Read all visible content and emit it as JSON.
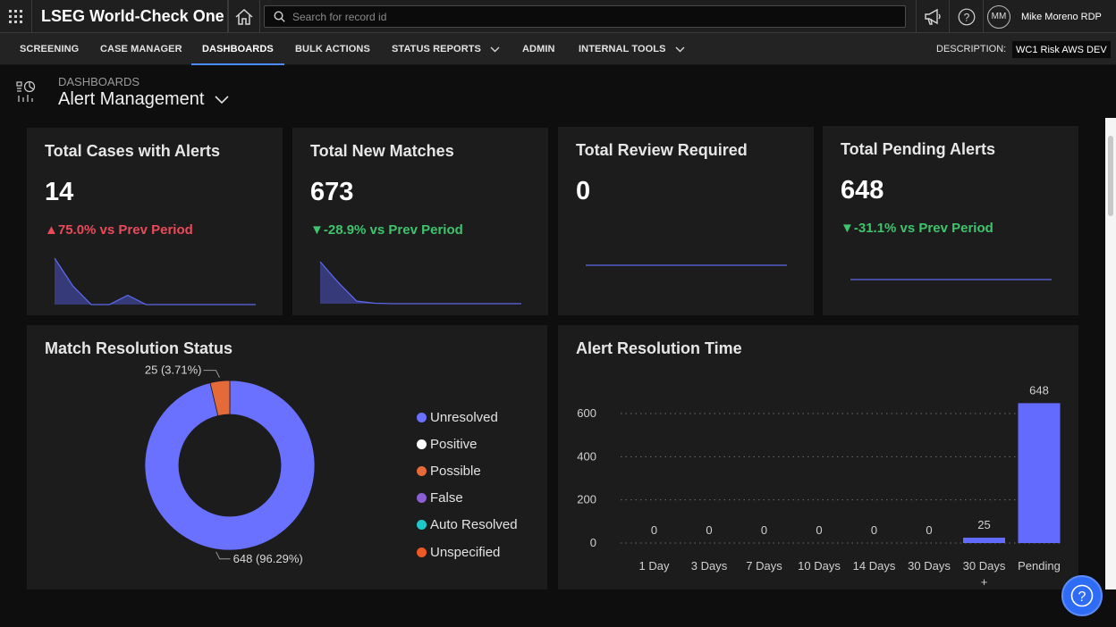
{
  "app": {
    "title": "LSEG World-Check One",
    "search_placeholder": "Search for record id",
    "user_initials": "MM",
    "user_name": "Mike Moreno RDP"
  },
  "nav": {
    "items": [
      {
        "label": "SCREENING",
        "has_dropdown": false,
        "active": false
      },
      {
        "label": "CASE MANAGER",
        "has_dropdown": false,
        "active": false
      },
      {
        "label": "DASHBOARDS",
        "has_dropdown": false,
        "active": true
      },
      {
        "label": "BULK ACTIONS",
        "has_dropdown": false,
        "active": false
      },
      {
        "label": "STATUS REPORTS",
        "has_dropdown": true,
        "active": false
      },
      {
        "label": "ADMIN",
        "has_dropdown": false,
        "active": false
      },
      {
        "label": "INTERNAL TOOLS",
        "has_dropdown": true,
        "active": false
      }
    ],
    "description_label": "DESCRIPTION:",
    "description_value": "WC1 Risk AWS DEV"
  },
  "page": {
    "breadcrumb": "DASHBOARDS",
    "title": "Alert Management"
  },
  "kpis": [
    {
      "title": "Total Cases with Alerts",
      "value": "14",
      "trend": "75.0% vs Prev Period",
      "direction": "up",
      "color": "#ea4a5a",
      "sparkline": [
        10,
        4,
        0,
        0,
        2,
        0,
        0,
        0,
        0,
        0,
        0,
        0
      ]
    },
    {
      "title": "Total New Matches",
      "value": "673",
      "trend": "-28.9% vs Prev Period",
      "direction": "down",
      "color": "#3ec46d",
      "sparkline": [
        10,
        5,
        0.6,
        0.1,
        0,
        0,
        0,
        0,
        0,
        0,
        0,
        0
      ]
    },
    {
      "title": "Total Review Required",
      "value": "0",
      "trend": "",
      "direction": "none",
      "color": "#5b67ea",
      "sparkline": [
        0,
        0,
        0,
        0,
        0,
        0,
        0,
        0,
        0,
        0,
        0,
        0
      ]
    },
    {
      "title": "Total Pending Alerts",
      "value": "648",
      "trend": "-31.1% vs Prev Period",
      "direction": "down",
      "color": "#3ec46d",
      "sparkline": [
        0,
        0,
        0,
        0,
        0,
        0,
        0,
        0,
        0,
        0,
        0,
        0
      ]
    }
  ],
  "match_resolution": {
    "title": "Match Resolution Status",
    "chart_data": {
      "type": "pie",
      "donut": true,
      "slices": [
        {
          "label": "Unresolved",
          "value": 648,
          "percent": 96.29,
          "color": "#6a70ff",
          "callout": "648 (96.29%)"
        },
        {
          "label": "Possible",
          "value": 25,
          "percent": 3.71,
          "color": "#e46a3a",
          "callout": "25 (3.71%)"
        }
      ],
      "legend": [
        {
          "label": "Unresolved",
          "color": "#6a70ff"
        },
        {
          "label": "Positive",
          "color": "#ffffff"
        },
        {
          "label": "Possible",
          "color": "#e46a3a"
        },
        {
          "label": "False",
          "color": "#8a5fd1"
        },
        {
          "label": "Auto Resolved",
          "color": "#1fc8c8"
        },
        {
          "label": "Unspecified",
          "color": "#ee5a24"
        }
      ],
      "legend_position": "right"
    }
  },
  "alert_resolution": {
    "title": "Alert Resolution Time",
    "chart_data": {
      "type": "bar",
      "categories": [
        "1 Day",
        "3 Days",
        "7 Days",
        "10 Days",
        "14 Days",
        "30 Days",
        "30 Days +",
        "Pending"
      ],
      "values": [
        0,
        0,
        0,
        0,
        0,
        0,
        25,
        648
      ],
      "ylim": [
        0,
        700
      ],
      "yticks": [
        0,
        200,
        400,
        600
      ],
      "grid": true,
      "bar_color": "#636bff"
    }
  },
  "colors": {
    "accent": "#4d8dfb",
    "help_button": "#2f6cf6"
  }
}
